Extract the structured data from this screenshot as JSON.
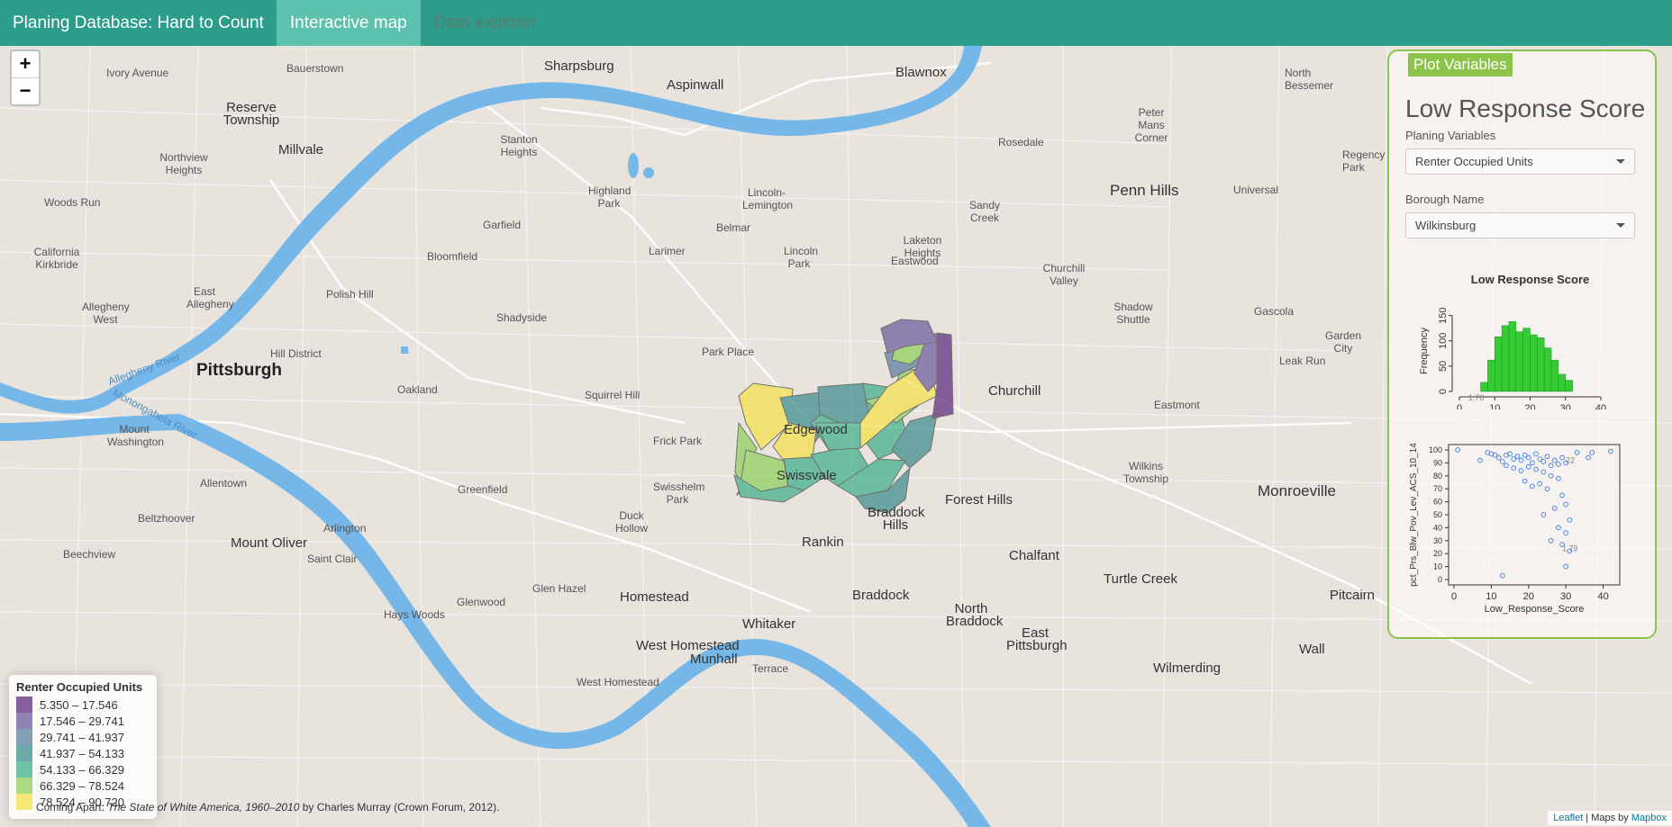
{
  "navbar": {
    "brand": "Planing Database: Hard to Count",
    "tabs": [
      {
        "label": "Interactive map",
        "active": true
      },
      {
        "label": "Data explorer",
        "active": false
      }
    ]
  },
  "zoom": {
    "in_label": "+",
    "out_label": "−"
  },
  "map_labels": [
    {
      "text": "Ivory Avenue",
      "kind": "normal"
    },
    {
      "text": "Bauerstown",
      "kind": "normal"
    },
    {
      "text": "Sharpsburg",
      "kind": "big"
    },
    {
      "text": "Aspinwall",
      "kind": "big"
    },
    {
      "text": "Blawnox",
      "kind": "big"
    },
    {
      "text": "North Bessemer",
      "kind": "normal"
    },
    {
      "text": "Reserve Township",
      "kind": "big"
    },
    {
      "text": "Millvale",
      "kind": "big"
    },
    {
      "text": "Stanton Heights",
      "kind": "normal"
    },
    {
      "text": "Peter Mans Corner",
      "kind": "normal"
    },
    {
      "text": "Regency Park",
      "kind": "normal"
    },
    {
      "text": "Rosedale",
      "kind": "normal"
    },
    {
      "text": "Northview Heights",
      "kind": "normal"
    },
    {
      "text": "Lincoln-Lemington",
      "kind": "normal"
    },
    {
      "text": "Sandy Creek",
      "kind": "normal"
    },
    {
      "text": "Penn Hills",
      "kind": "bigger"
    },
    {
      "text": "Universal",
      "kind": "normal"
    },
    {
      "text": "Woods Run",
      "kind": "normal"
    },
    {
      "text": "Highland Park",
      "kind": "normal"
    },
    {
      "text": "Garfield",
      "kind": "normal"
    },
    {
      "text": "Belmar",
      "kind": "normal"
    },
    {
      "text": "California Kirkbride",
      "kind": "normal"
    },
    {
      "text": "Bloomfield",
      "kind": "normal"
    },
    {
      "text": "Larimer",
      "kind": "normal"
    },
    {
      "text": "Lincoln Park",
      "kind": "normal"
    },
    {
      "text": "Laketon Heights",
      "kind": "normal"
    },
    {
      "text": "Eastwood",
      "kind": "normal"
    },
    {
      "text": "Churchill Valley",
      "kind": "normal"
    },
    {
      "text": "Polish Hill",
      "kind": "normal"
    },
    {
      "text": "East Allegheny",
      "kind": "normal"
    },
    {
      "text": "Allegheny West",
      "kind": "normal"
    },
    {
      "text": "Shadyside",
      "kind": "normal"
    },
    {
      "text": "Shadow Shuttle",
      "kind": "normal"
    },
    {
      "text": "Gascola",
      "kind": "normal"
    },
    {
      "text": "Garden City",
      "kind": "normal"
    },
    {
      "text": "Hill District",
      "kind": "normal"
    },
    {
      "text": "Park Place",
      "kind": "normal"
    },
    {
      "text": "Leak Run",
      "kind": "normal"
    },
    {
      "text": "Pittsburgh",
      "kind": "city"
    },
    {
      "text": "Oakland",
      "kind": "normal"
    },
    {
      "text": "Squirrel Hill",
      "kind": "normal"
    },
    {
      "text": "Churchill",
      "kind": "big"
    },
    {
      "text": "Eastmont",
      "kind": "normal"
    },
    {
      "text": "Mount Washington",
      "kind": "normal"
    },
    {
      "text": "Edgewood",
      "kind": "big"
    },
    {
      "text": "Frick Park",
      "kind": "normal"
    },
    {
      "text": "Wilkins Township",
      "kind": "normal"
    },
    {
      "text": "Swissvale",
      "kind": "big"
    },
    {
      "text": "Monroeville",
      "kind": "bigger"
    },
    {
      "text": "Allentown",
      "kind": "normal"
    },
    {
      "text": "Greenfield",
      "kind": "normal"
    },
    {
      "text": "Swisshelm Park",
      "kind": "normal"
    },
    {
      "text": "Forest Hills",
      "kind": "big"
    },
    {
      "text": "Beltzhoover",
      "kind": "normal"
    },
    {
      "text": "Braddock Hills",
      "kind": "big"
    },
    {
      "text": "Duck Hollow",
      "kind": "normal"
    },
    {
      "text": "Arlington",
      "kind": "normal"
    },
    {
      "text": "Mount Oliver",
      "kind": "big"
    },
    {
      "text": "Rankin",
      "kind": "big"
    },
    {
      "text": "Saint Clair",
      "kind": "normal"
    },
    {
      "text": "Chalfant",
      "kind": "big"
    },
    {
      "text": "Beechview",
      "kind": "normal"
    },
    {
      "text": "Glen Hazel",
      "kind": "normal"
    },
    {
      "text": "Turtle Creek",
      "kind": "big"
    },
    {
      "text": "Homestead",
      "kind": "big"
    },
    {
      "text": "Glenwood",
      "kind": "normal"
    },
    {
      "text": "Braddock",
      "kind": "big"
    },
    {
      "text": "Pitcairn",
      "kind": "big"
    },
    {
      "text": "Hays Woods",
      "kind": "normal"
    },
    {
      "text": "North Braddock",
      "kind": "big"
    },
    {
      "text": "Whitaker",
      "kind": "big"
    },
    {
      "text": "East Pittsburgh",
      "kind": "big"
    },
    {
      "text": "West Homestead",
      "kind": "big"
    },
    {
      "text": "Munhall",
      "kind": "big"
    },
    {
      "text": "Wall",
      "kind": "big"
    },
    {
      "text": "Terrace",
      "kind": "normal"
    },
    {
      "text": "Wilmerding",
      "kind": "big"
    },
    {
      "text": "West Homestead",
      "kind": "normal"
    },
    {
      "text": "Allegheny River",
      "kind": "river"
    },
    {
      "text": "Monongahela River",
      "kind": "river"
    }
  ],
  "legend": {
    "title": "Renter Occupied Units",
    "items": [
      {
        "label": "5.350 – 17.546",
        "color": "#5c2a7e"
      },
      {
        "label": "17.546 – 29.741",
        "color": "#6c5b9e"
      },
      {
        "label": "29.741 – 41.937",
        "color": "#5b7fa0"
      },
      {
        "label": "41.937 – 54.133",
        "color": "#3c8d8d"
      },
      {
        "label": "54.133 – 66.329",
        "color": "#3fb08a"
      },
      {
        "label": "66.329 – 78.524",
        "color": "#8fd15c"
      },
      {
        "label": "78.524 – 90.720",
        "color": "#f4e14a"
      }
    ]
  },
  "caption": {
    "prefix": "Coming Apart: ",
    "italic": "The State of White America, 1960–2010",
    "suffix": " by Charles Murray (Crown Forum, 2012)."
  },
  "attribution": {
    "leaflet": "Leaflet",
    "sep": " | Maps by ",
    "mapbox": "Mapbox"
  },
  "panel": {
    "button_label": "Plot Variables",
    "title": "Low Response Score",
    "planing_label": "Planing Variables",
    "planing_value": "Renter Occupied Units",
    "borough_label": "Borough Name",
    "borough_value": "Wilkinsburg"
  },
  "chart_data": [
    {
      "type": "bar",
      "title": "Low Response Score",
      "xlabel": "Low Response Score",
      "ylabel": "Frequency",
      "xlim": [
        0,
        40
      ],
      "ylim": [
        0,
        160
      ],
      "xticks": [
        0,
        10,
        20,
        30,
        40
      ],
      "yticks": [
        0,
        50,
        100,
        150
      ],
      "bin_width": 2,
      "bins_start": [
        6,
        8,
        10,
        12,
        14,
        16,
        18,
        20,
        22,
        24,
        26,
        28,
        30
      ],
      "values": [
        18,
        62,
        108,
        130,
        138,
        118,
        125,
        112,
        106,
        86,
        62,
        34,
        22
      ],
      "annotation": "1.76"
    },
    {
      "type": "scatter",
      "xlabel": "Low_Response_Score",
      "ylabel": "pct_Prs_Blw_Pov_Lev_ACS_10_14",
      "xlim": [
        0,
        43
      ],
      "ylim": [
        0,
        100
      ],
      "xticks": [
        0,
        10,
        20,
        30,
        40
      ],
      "yticks": [
        0,
        10,
        20,
        30,
        40,
        50,
        60,
        70,
        80,
        90,
        100
      ],
      "points": [
        [
          1,
          100
        ],
        [
          7,
          92
        ],
        [
          9,
          98
        ],
        [
          10,
          97
        ],
        [
          11,
          96
        ],
        [
          12,
          94
        ],
        [
          13,
          91
        ],
        [
          14,
          96
        ],
        [
          15,
          97
        ],
        [
          16,
          93
        ],
        [
          17,
          95
        ],
        [
          18,
          92
        ],
        [
          19,
          96
        ],
        [
          20,
          94
        ],
        [
          21,
          90
        ],
        [
          22,
          97
        ],
        [
          23,
          93
        ],
        [
          24,
          91
        ],
        [
          25,
          95
        ],
        [
          26,
          88
        ],
        [
          27,
          92
        ],
        [
          28,
          89
        ],
        [
          29,
          94
        ],
        [
          30,
          90
        ],
        [
          14,
          88
        ],
        [
          16,
          86
        ],
        [
          18,
          84
        ],
        [
          20,
          87
        ],
        [
          22,
          85
        ],
        [
          24,
          83
        ],
        [
          26,
          80
        ],
        [
          28,
          78
        ],
        [
          19,
          76
        ],
        [
          21,
          72
        ],
        [
          23,
          74
        ],
        [
          25,
          70
        ],
        [
          29,
          65
        ],
        [
          30,
          58
        ],
        [
          27,
          55
        ],
        [
          24,
          50
        ],
        [
          31,
          46
        ],
        [
          28,
          40
        ],
        [
          30,
          36
        ],
        [
          26,
          30
        ],
        [
          29,
          27
        ],
        [
          31,
          22
        ],
        [
          13,
          3
        ],
        [
          33,
          98
        ],
        [
          37,
          98
        ],
        [
          42,
          99
        ],
        [
          36,
          94
        ],
        [
          30,
          10
        ]
      ],
      "annotations": [
        "22",
        "1.79"
      ]
    }
  ]
}
